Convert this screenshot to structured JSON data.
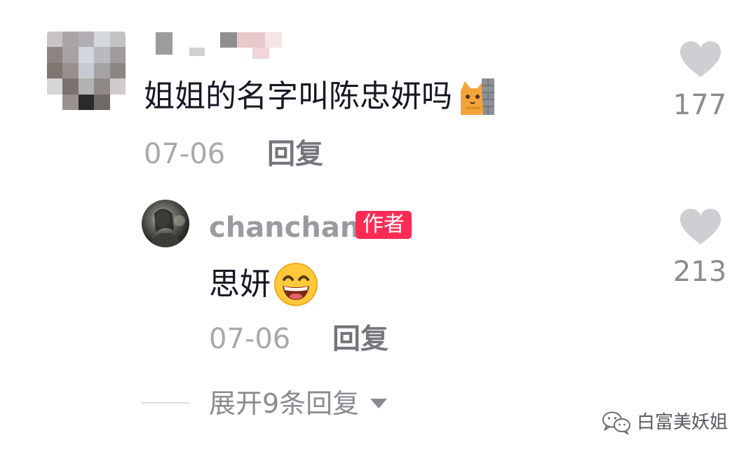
{
  "comment": {
    "username": "",
    "text": "姐姐的名字叫陈忠妍吗",
    "emoji": "cat-peeking-emoji",
    "date": "07-06",
    "reply_label": "回复",
    "like_count": "177"
  },
  "reply": {
    "username": "chanchan",
    "badge": "作者",
    "text": "思妍",
    "emoji": "grinning-face-emoji",
    "date": "07-06",
    "reply_label": "回复",
    "like_count": "213"
  },
  "expand": {
    "label": "展开9条回复"
  },
  "watermark": {
    "label": "白富美妖姐"
  },
  "colors": {
    "badge": "#fe2c55",
    "like_icon": "#cfcfd3",
    "meta_text": "#a8a8ad",
    "reply_text": "#75757c"
  }
}
